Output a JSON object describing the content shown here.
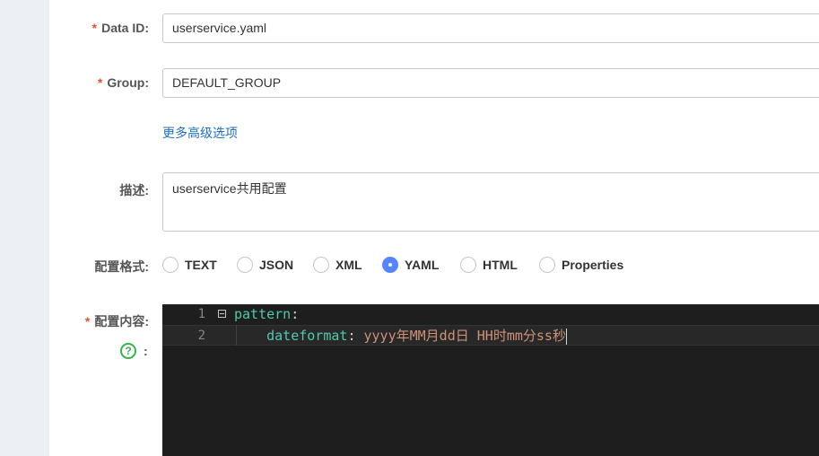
{
  "form": {
    "data_id": {
      "required": "*",
      "label": "Data ID:",
      "value": "userservice.yaml"
    },
    "group": {
      "required": "*",
      "label": "Group:",
      "value": "DEFAULT_GROUP"
    },
    "advanced_link": "更多高级选项",
    "description": {
      "label": "描述:",
      "value": "userservice共用配置"
    },
    "format": {
      "label": "配置格式:",
      "options": [
        "TEXT",
        "JSON",
        "XML",
        "YAML",
        "HTML",
        "Properties"
      ],
      "selected": "YAML"
    },
    "content": {
      "required": "*",
      "label": "配置内容:",
      "help_icon": "question-circle-icon",
      "help_char": "?",
      "colon": ":"
    }
  },
  "editor": {
    "lines": [
      {
        "num": "1",
        "key": "pattern",
        "colon": ":",
        "value": ""
      },
      {
        "num": "2",
        "indent": "    ",
        "key": "dateformat",
        "colon": ": ",
        "value": "yyyy年MM月dd日 HH时mm分ss秒"
      }
    ]
  },
  "colors": {
    "accent": "#5584ff",
    "link": "#1f6fc0",
    "required": "#e8522f",
    "help": "#36b54a",
    "editor_bg": "#1e1e1e"
  }
}
